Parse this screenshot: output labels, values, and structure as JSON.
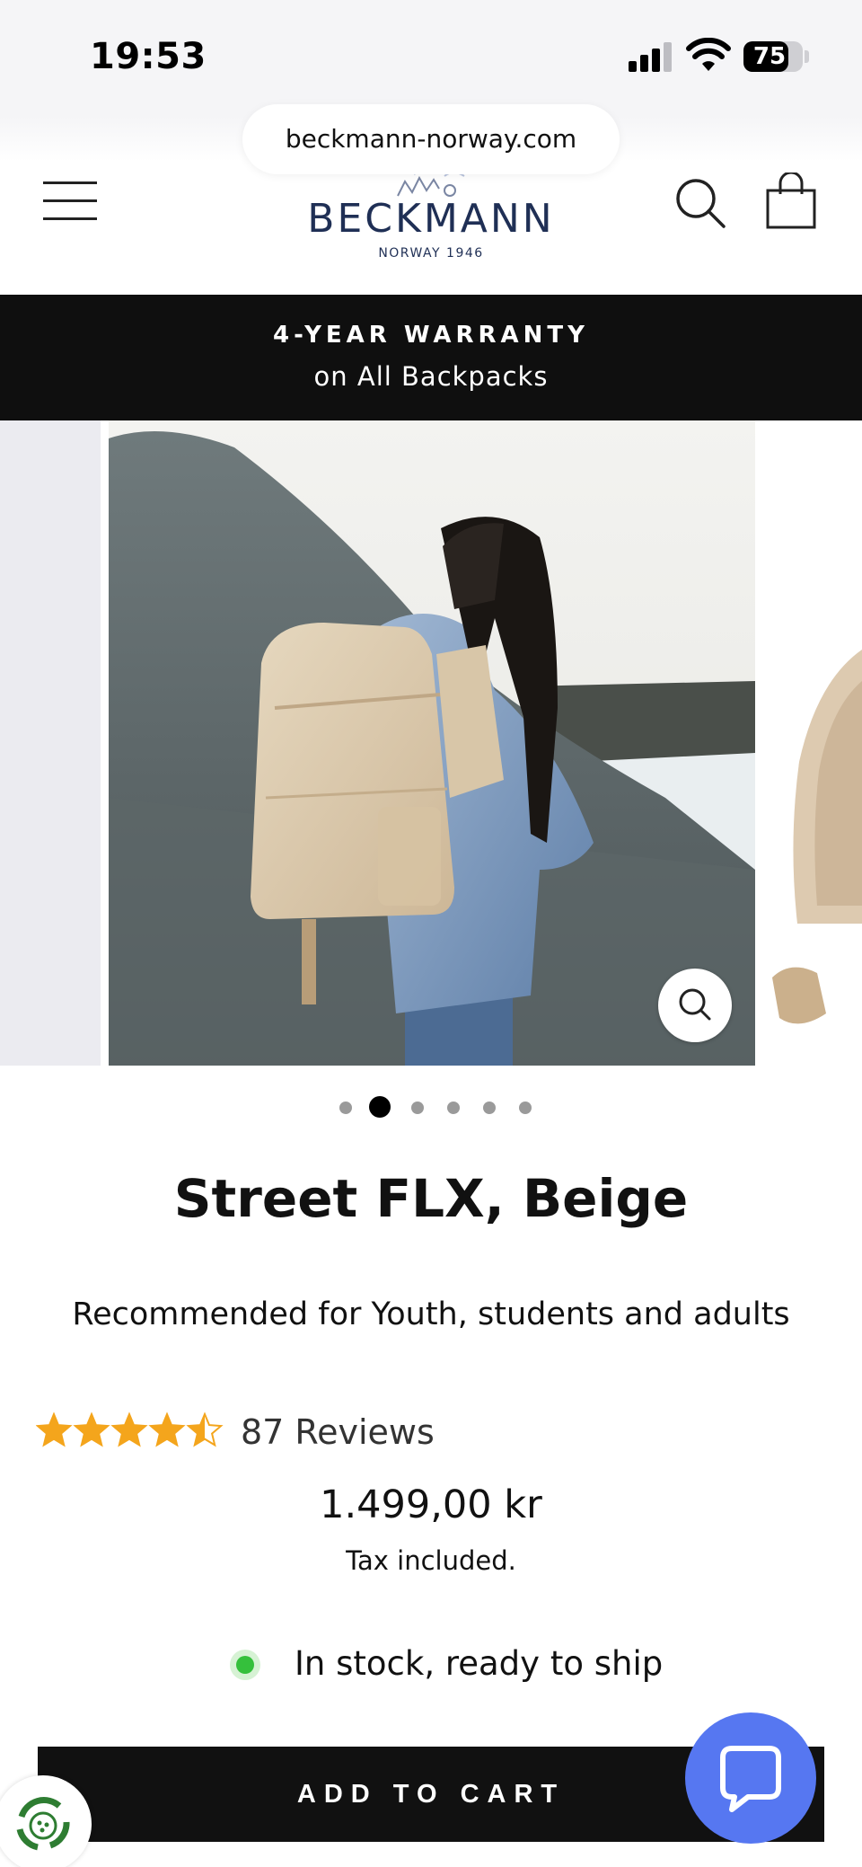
{
  "status_bar": {
    "time": "19:53",
    "battery_level": "75",
    "battery_fraction": 0.75
  },
  "browser": {
    "url": "beckmann-norway.com"
  },
  "header": {
    "brand_name": "BECKMANN",
    "brand_tagline": "NORWAY 1946",
    "menu_icon": "hamburger-menu-icon",
    "search_icon": "search-icon",
    "cart_icon": "shopping-bag-icon"
  },
  "announcement": {
    "line1": "4-YEAR WARRANTY",
    "line2": "on All Backpacks"
  },
  "gallery": {
    "slide_count": 6,
    "active_slide": 2,
    "zoom_icon": "zoom-icon"
  },
  "product": {
    "title": "Street FLX, Beige",
    "subtitle": "Recommended for Youth, students and adults",
    "rating": 4.5,
    "rating_max": 5,
    "reviews_label": "87 Reviews",
    "price": "1.499,00 kr",
    "tax_note": "Tax included.",
    "stock_text": "In stock, ready to ship",
    "add_to_cart_label": "ADD TO CART"
  },
  "colors": {
    "brand_navy": "#1f2f55",
    "star": "#f4a51c",
    "stock_green": "#35c03c",
    "chat_blue": "#5677f1",
    "button_black": "#111111"
  }
}
